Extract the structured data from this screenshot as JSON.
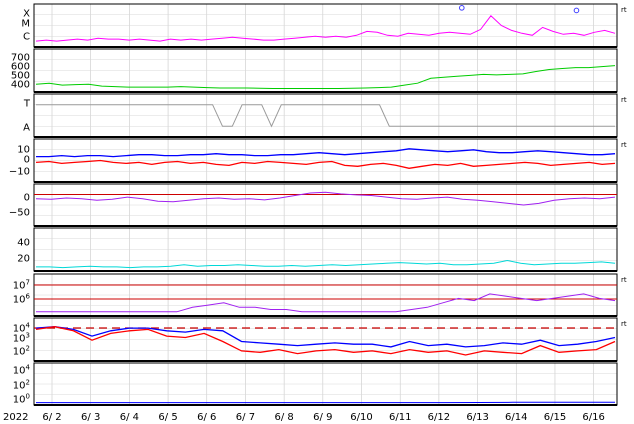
{
  "chart_data": {
    "type": "line",
    "year_label": "2022",
    "x_labels": [
      "6/ 2",
      "6/ 3",
      "6/ 4",
      "6/ 5",
      "6/ 6",
      "6/ 7",
      "6/ 8",
      "6/ 9",
      "6/10",
      "6/11",
      "6/12",
      "6/13",
      "6/14",
      "6/15",
      "6/16"
    ],
    "panels": [
      {
        "id": "xray",
        "y_ticks": [
          "X",
          "M",
          "C"
        ],
        "marker": "rt",
        "series": [
          {
            "color": "#ff00ff",
            "values": [
              4,
              5,
              4,
              5,
              6,
              5,
              7,
              6,
              6,
              5,
              6,
              5,
              4,
              6,
              5,
              6,
              5,
              6,
              7,
              8,
              7,
              6,
              5,
              5,
              6,
              7,
              8,
              9,
              8,
              9,
              8,
              10,
              14,
              13,
              10,
              9,
              12,
              11,
              10,
              12,
              13,
              12,
              11,
              16,
              30,
              20,
              15,
              12,
              10,
              18,
              14,
              11,
              12,
              10,
              13,
              15,
              12
            ]
          }
        ],
        "peaks": [
          {
            "day": 12.58,
            "level": 0.95
          },
          {
            "day": 15.55,
            "level": 0.88
          }
        ]
      },
      {
        "id": "solar-wind-speed",
        "y_ticks": [
          "700",
          "600",
          "500",
          "400"
        ],
        "y_range": [
          350,
          750
        ],
        "series": [
          {
            "color": "#00cc00",
            "values": [
              410,
              420,
              400,
              405,
              410,
              390,
              385,
              380,
              380,
              380,
              380,
              385,
              380,
              375,
              370,
              370,
              370,
              368,
              365,
              365,
              365,
              365,
              365,
              365,
              368,
              370,
              375,
              380,
              400,
              420,
              470,
              480,
              490,
              500,
              510,
              505,
              510,
              515,
              540,
              560,
              570,
              580,
              580,
              590,
              600
            ]
          }
        ]
      },
      {
        "id": "imf-direction",
        "y_ticks": [
          "T",
          "A"
        ],
        "marker": "rt",
        "series": [
          {
            "color": "#999999",
            "values": [
              1,
              1,
              1,
              1,
              1,
              1,
              1,
              1,
              1,
              1,
              1,
              1,
              1,
              1,
              1,
              1,
              1,
              1,
              1,
              0,
              0,
              1,
              1,
              1,
              0,
              1,
              1,
              1,
              1,
              1,
              1,
              1,
              1,
              1,
              1,
              1,
              0,
              0,
              0,
              0,
              0,
              0,
              0,
              0,
              0,
              0,
              0,
              0,
              0,
              0,
              0,
              0,
              0,
              0,
              0,
              0,
              0,
              0,
              0,
              0
            ]
          }
        ]
      },
      {
        "id": "bt-bz",
        "y_ticks": [
          "10",
          "0",
          "−10"
        ],
        "y_range": [
          -20,
          20
        ],
        "marker": "rt",
        "series": [
          {
            "color": "#0000ff",
            "values": [
              4,
              4,
              5,
              4,
              5,
              5,
              4,
              5,
              6,
              6,
              5,
              5,
              6,
              6,
              7,
              6,
              6,
              5,
              5,
              6,
              6,
              7,
              8,
              7,
              6,
              7,
              8,
              9,
              10,
              12,
              11,
              10,
              9,
              10,
              11,
              9,
              8,
              8,
              9,
              10,
              9,
              8,
              7,
              6,
              6,
              7
            ]
          },
          {
            "color": "#ff0000",
            "values": [
              -2,
              -1,
              -3,
              -2,
              -1,
              0,
              -2,
              -3,
              -2,
              -4,
              -2,
              -1,
              -3,
              -2,
              -4,
              -5,
              -2,
              -3,
              -1,
              -2,
              -3,
              -4,
              -2,
              -1,
              -5,
              -6,
              -4,
              -3,
              -5,
              -8,
              -6,
              -4,
              -5,
              -3,
              -6,
              -5,
              -4,
              -3,
              -2,
              -3,
              -5,
              -4,
              -3,
              -2,
              -4,
              -3
            ]
          }
        ]
      },
      {
        "id": "dst",
        "y_ticks": [
          "0",
          "−50"
        ],
        "y_range": [
          -90,
          30
        ],
        "series": [
          {
            "color": "#a020f0",
            "values": [
              -10,
              -12,
              -8,
              -10,
              -15,
              -12,
              -5,
              -10,
              -18,
              -20,
              -15,
              -10,
              -8,
              -12,
              -10,
              -14,
              -8,
              0,
              8,
              10,
              5,
              2,
              0,
              -5,
              -10,
              -12,
              -8,
              -5,
              -12,
              -15,
              -20,
              -25,
              -30,
              -25,
              -15,
              -10,
              -8,
              -10,
              -5
            ]
          }
        ]
      },
      {
        "id": "proton-density",
        "y_ticks": [
          "40",
          "20"
        ],
        "y_range": [
          0,
          55
        ],
        "series": [
          {
            "color": "#00d8d8",
            "values": [
              3,
              3,
              2,
              3,
              4,
              3,
              3,
              2,
              3,
              3,
              4,
              6,
              4,
              5,
              5,
              6,
              5,
              4,
              4,
              5,
              4,
              5,
              6,
              5,
              6,
              7,
              8,
              9,
              8,
              7,
              8,
              6,
              6,
              7,
              8,
              12,
              8,
              6,
              7,
              8,
              8,
              9,
              10,
              8
            ]
          }
        ]
      },
      {
        "id": "electron-flux",
        "y_ticks": [
          "10^7",
          "10^6"
        ],
        "marker": "rt",
        "series": [
          {
            "color": "#a020f0",
            "values": [
              0,
              0,
              0,
              0,
              0,
              0,
              0,
              0,
              0,
              0,
              0.2,
              0.3,
              0.4,
              0.2,
              0.2,
              0.1,
              0.1,
              0,
              0,
              0,
              0,
              0,
              0,
              0,
              0.1,
              0.2,
              0.4,
              0.6,
              0.5,
              0.8,
              0.7,
              0.6,
              0.5,
              0.6,
              0.7,
              0.8,
              0.6,
              0.5
            ]
          }
        ]
      },
      {
        "id": "proton-flux",
        "y_ticks": [
          "10^4",
          "10^3",
          "10^2"
        ],
        "marker": "rt",
        "series": [
          {
            "color": "#0000ff",
            "values": [
              3.2,
              3.3,
              3.1,
              2.6,
              3.0,
              3.2,
              3.2,
              3.0,
              2.9,
              3.1,
              3.0,
              2.2,
              2.1,
              2.0,
              1.9,
              2.0,
              2.1,
              2.0,
              2.0,
              1.8,
              2.2,
              1.9,
              2.0,
              1.8,
              1.9,
              2.1,
              2.0,
              2.3,
              1.9,
              2.0,
              2.2,
              2.5
            ]
          },
          {
            "color": "#ff0000",
            "values": [
              3.1,
              3.3,
              3.0,
              2.3,
              2.8,
              3.0,
              3.1,
              2.6,
              2.5,
              2.8,
              2.2,
              1.5,
              1.4,
              1.6,
              1.3,
              1.5,
              1.6,
              1.4,
              1.5,
              1.3,
              1.6,
              1.4,
              1.5,
              1.2,
              1.5,
              1.4,
              1.3,
              1.9,
              1.4,
              1.5,
              1.6,
              2.2
            ]
          }
        ]
      },
      {
        "id": "neutron",
        "y_ticks": [
          "10^4",
          "10^2",
          "10^0"
        ],
        "series": [
          {
            "color": "#0000ff",
            "values": [
              0.05,
              0.05,
              0.05,
              0.05,
              0.05,
              0.05,
              0.05,
              0.05,
              0.05,
              0.05,
              0.05,
              0.05,
              0.05,
              0.06,
              0.08,
              0.1,
              0.1,
              0.1
            ]
          }
        ]
      }
    ]
  }
}
